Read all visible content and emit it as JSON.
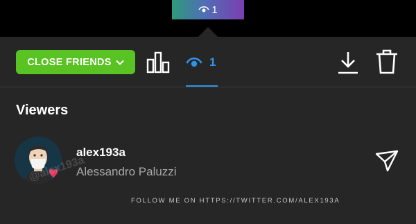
{
  "story_thumbnail": {
    "view_count": "1",
    "eye_icon": "eye-icon"
  },
  "toolbar": {
    "close_friends_label": "CLOSE FRIENDS",
    "views_count": "1",
    "colors": {
      "close_friends": "#58c322",
      "active_tab": "#2f93e8"
    }
  },
  "viewers": {
    "title": "Viewers",
    "items": [
      {
        "username": "alex193a",
        "full_name": "Alessandro Paluzzi"
      }
    ]
  },
  "watermark": "@alex193a",
  "footer_note": "FOLLOW ME ON HTTPS://TWITTER.COM/ALEX193A"
}
